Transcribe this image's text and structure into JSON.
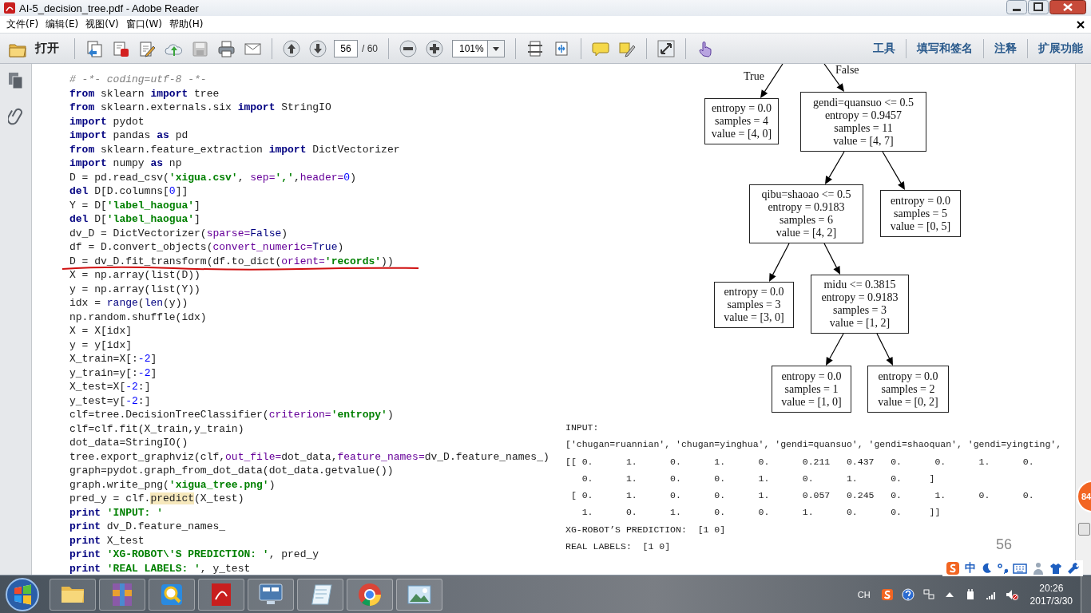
{
  "window": {
    "title": "AI-5_decision_tree.pdf - Adobe Reader"
  },
  "menu": [
    {
      "label": "文件(F)"
    },
    {
      "label": "编辑(E)"
    },
    {
      "label": "视图(V)"
    },
    {
      "label": "窗口(W)"
    },
    {
      "label": "帮助(H)"
    }
  ],
  "toolbar": {
    "open_label": "打开",
    "page_number": "56",
    "page_count": "/ 60",
    "zoom": "101%",
    "panels": [
      "工具",
      "填写和签名",
      "注释",
      "扩展功能"
    ]
  },
  "code": [
    {
      "underlined": false,
      "segments": [
        {
          "kind": "comment",
          "text": "# -*- coding=utf-8 -*-"
        }
      ]
    },
    {
      "underlined": false,
      "segments": [
        {
          "kind": "kw",
          "text": "from"
        },
        {
          "kind": "plain",
          "text": " sklearn "
        },
        {
          "kind": "kw",
          "text": "import"
        },
        {
          "kind": "plain",
          "text": " tree"
        }
      ]
    },
    {
      "underlined": false,
      "segments": [
        {
          "kind": "kw",
          "text": "from"
        },
        {
          "kind": "plain",
          "text": " sklearn.externals.six "
        },
        {
          "kind": "kw",
          "text": "import"
        },
        {
          "kind": "plain",
          "text": " StringIO"
        }
      ]
    },
    {
      "underlined": false,
      "segments": [
        {
          "kind": "kw",
          "text": "import"
        },
        {
          "kind": "plain",
          "text": " pydot"
        }
      ]
    },
    {
      "underlined": false,
      "segments": [
        {
          "kind": "kw",
          "text": "import"
        },
        {
          "kind": "plain",
          "text": " pandas "
        },
        {
          "kind": "kw",
          "text": "as"
        },
        {
          "kind": "plain",
          "text": " pd"
        }
      ]
    },
    {
      "underlined": false,
      "segments": [
        {
          "kind": "kw",
          "text": "from"
        },
        {
          "kind": "plain",
          "text": " sklearn.feature_extraction "
        },
        {
          "kind": "kw",
          "text": "import"
        },
        {
          "kind": "plain",
          "text": " DictVectorizer"
        }
      ]
    },
    {
      "underlined": false,
      "segments": [
        {
          "kind": "kw",
          "text": "import"
        },
        {
          "kind": "plain",
          "text": " numpy "
        },
        {
          "kind": "kw",
          "text": "as"
        },
        {
          "kind": "plain",
          "text": " np"
        }
      ]
    },
    {
      "underlined": false,
      "segments": [
        {
          "kind": "plain",
          "text": "D = pd.read_csv("
        },
        {
          "kind": "str",
          "text": "'xigua.csv'"
        },
        {
          "kind": "plain",
          "text": ", "
        },
        {
          "kind": "param",
          "text": "sep="
        },
        {
          "kind": "str",
          "text": "','"
        },
        {
          "kind": "plain",
          "text": ","
        },
        {
          "kind": "param",
          "text": "header="
        },
        {
          "kind": "num",
          "text": "0"
        },
        {
          "kind": "plain",
          "text": ")"
        }
      ]
    },
    {
      "underlined": false,
      "segments": [
        {
          "kind": "kw",
          "text": "del"
        },
        {
          "kind": "plain",
          "text": " D[D.columns["
        },
        {
          "kind": "num",
          "text": "0"
        },
        {
          "kind": "plain",
          "text": "]]"
        }
      ]
    },
    {
      "underlined": false,
      "segments": [
        {
          "kind": "plain",
          "text": "Y = D["
        },
        {
          "kind": "str",
          "text": "'label_haogua'"
        },
        {
          "kind": "plain",
          "text": "]"
        }
      ]
    },
    {
      "underlined": false,
      "segments": [
        {
          "kind": "kw",
          "text": "del"
        },
        {
          "kind": "plain",
          "text": " D["
        },
        {
          "kind": "str",
          "text": "'label_haogua'"
        },
        {
          "kind": "plain",
          "text": "]"
        }
      ]
    },
    {
      "underlined": false,
      "segments": [
        {
          "kind": "plain",
          "text": "dv_D = DictVectorizer("
        },
        {
          "kind": "param",
          "text": "sparse="
        },
        {
          "kind": "builtin",
          "text": "False"
        },
        {
          "kind": "plain",
          "text": ")"
        }
      ]
    },
    {
      "underlined": false,
      "segments": [
        {
          "kind": "plain",
          "text": "df = D.convert_objects("
        },
        {
          "kind": "param",
          "text": "convert_numeric="
        },
        {
          "kind": "builtin",
          "text": "True"
        },
        {
          "kind": "plain",
          "text": ")"
        }
      ]
    },
    {
      "underlined": true,
      "segments": [
        {
          "kind": "plain",
          "text": "D = dv_D.fit_transform(df.to_dict("
        },
        {
          "kind": "param",
          "text": "orient="
        },
        {
          "kind": "str",
          "text": "'records'"
        },
        {
          "kind": "plain",
          "text": "))"
        }
      ]
    },
    {
      "underlined": false,
      "segments": [
        {
          "kind": "plain",
          "text": "X = np.array(list(D))"
        }
      ]
    },
    {
      "underlined": false,
      "segments": [
        {
          "kind": "plain",
          "text": "y = np.array(list(Y))"
        }
      ]
    },
    {
      "underlined": false,
      "segments": [
        {
          "kind": "plain",
          "text": "idx = "
        },
        {
          "kind": "builtin",
          "text": "range"
        },
        {
          "kind": "plain",
          "text": "("
        },
        {
          "kind": "builtin",
          "text": "len"
        },
        {
          "kind": "plain",
          "text": "(y))"
        }
      ]
    },
    {
      "underlined": false,
      "segments": [
        {
          "kind": "plain",
          "text": "np.random.shuffle(idx)"
        }
      ]
    },
    {
      "underlined": false,
      "segments": [
        {
          "kind": "plain",
          "text": "X = X[idx]"
        }
      ]
    },
    {
      "underlined": false,
      "segments": [
        {
          "kind": "plain",
          "text": "y = y[idx]"
        }
      ]
    },
    {
      "underlined": false,
      "segments": [
        {
          "kind": "plain",
          "text": "X_train=X[:"
        },
        {
          "kind": "num",
          "text": "-2"
        },
        {
          "kind": "plain",
          "text": "]"
        }
      ]
    },
    {
      "underlined": false,
      "segments": [
        {
          "kind": "plain",
          "text": "y_train=y[:"
        },
        {
          "kind": "num",
          "text": "-2"
        },
        {
          "kind": "plain",
          "text": "]"
        }
      ]
    },
    {
      "underlined": false,
      "segments": [
        {
          "kind": "plain",
          "text": "X_test=X["
        },
        {
          "kind": "num",
          "text": "-2"
        },
        {
          "kind": "plain",
          "text": ":]"
        }
      ]
    },
    {
      "underlined": false,
      "segments": [
        {
          "kind": "plain",
          "text": "y_test=y["
        },
        {
          "kind": "num",
          "text": "-2"
        },
        {
          "kind": "plain",
          "text": ":]"
        }
      ]
    },
    {
      "underlined": false,
      "segments": [
        {
          "kind": "plain",
          "text": "clf=tree.DecisionTreeClassifier("
        },
        {
          "kind": "param",
          "text": "criterion="
        },
        {
          "kind": "str",
          "text": "'entropy'"
        },
        {
          "kind": "plain",
          "text": ")"
        }
      ]
    },
    {
      "underlined": false,
      "segments": [
        {
          "kind": "plain",
          "text": "clf=clf.fit(X_train,y_train)"
        }
      ]
    },
    {
      "underlined": false,
      "segments": [
        {
          "kind": "plain",
          "text": "dot_data=StringIO()"
        }
      ]
    },
    {
      "underlined": false,
      "segments": [
        {
          "kind": "plain",
          "text": "tree.export_graphviz(clf,"
        },
        {
          "kind": "param",
          "text": "out_file="
        },
        {
          "kind": "plain",
          "text": "dot_data,"
        },
        {
          "kind": "param",
          "text": "feature_names="
        },
        {
          "kind": "plain",
          "text": "dv_D.feature_names_)"
        }
      ]
    },
    {
      "underlined": false,
      "segments": [
        {
          "kind": "plain",
          "text": "graph=pydot.graph_from_dot_data(dot_data.getvalue())"
        }
      ]
    },
    {
      "underlined": false,
      "segments": [
        {
          "kind": "plain",
          "text": "graph.write_png("
        },
        {
          "kind": "str",
          "text": "'xigua_tree.png'"
        },
        {
          "kind": "plain",
          "text": ")"
        }
      ]
    },
    {
      "underlined": false,
      "segments": [
        {
          "kind": "plain",
          "text": "pred_y = clf."
        },
        {
          "kind": "highlight",
          "text": "predict"
        },
        {
          "kind": "plain",
          "text": "(X_test)"
        }
      ]
    },
    {
      "underlined": false,
      "segments": [
        {
          "kind": "kw",
          "text": "print "
        },
        {
          "kind": "str",
          "text": "'INPUT: '"
        }
      ]
    },
    {
      "underlined": false,
      "segments": [
        {
          "kind": "kw",
          "text": "print"
        },
        {
          "kind": "plain",
          "text": " dv_D.feature_names_"
        }
      ]
    },
    {
      "underlined": false,
      "segments": [
        {
          "kind": "kw",
          "text": "print"
        },
        {
          "kind": "plain",
          "text": " X_test"
        }
      ]
    },
    {
      "underlined": false,
      "segments": [
        {
          "kind": "kw",
          "text": "print "
        },
        {
          "kind": "str",
          "text": "'XG-ROBOT\\'S PREDICTION: '"
        },
        {
          "kind": "plain",
          "text": ", pred_y"
        }
      ]
    },
    {
      "underlined": false,
      "segments": [
        {
          "kind": "kw",
          "text": "print "
        },
        {
          "kind": "str",
          "text": "'REAL LABELS: '"
        },
        {
          "kind": "plain",
          "text": ", y_test"
        }
      ]
    }
  ],
  "tree": {
    "children": [
      {
        "edge_label": "True",
        "lines": [
          "entropy = 0.0",
          "samples = 4",
          "value = [4, 0]"
        ]
      },
      {
        "edge_label": "False",
        "lines": [
          "gendi=quansuo <= 0.5",
          "entropy = 0.9457",
          "samples = 11",
          "value = [4, 7]"
        ],
        "children": [
          {
            "lines": [
              "qibu=shaoao <= 0.5",
              "entropy = 0.9183",
              "samples = 6",
              "value = [4, 2]"
            ],
            "children": [
              {
                "lines": [
                  "entropy = 0.0",
                  "samples = 3",
                  "value = [3, 0]"
                ]
              },
              {
                "lines": [
                  "midu <= 0.3815",
                  "entropy = 0.9183",
                  "samples = 3",
                  "value = [1, 2]"
                ],
                "children": [
                  {
                    "lines": [
                      "entropy = 0.0",
                      "samples = 1",
                      "value = [1, 0]"
                    ]
                  },
                  {
                    "lines": [
                      "entropy = 0.0",
                      "samples = 2",
                      "value = [0, 2]"
                    ]
                  }
                ]
              }
            ]
          },
          {
            "lines": [
              "entropy = 0.0",
              "samples = 5",
              "value = [0, 5]"
            ]
          }
        ]
      }
    ]
  },
  "output": [
    "INPUT:",
    "['chugan=ruannian', 'chugan=yinghua', 'gendi=quansuo', 'gendi=shaoquan', 'gendi=yingting',",
    "[[ 0.      1.      0.      1.      0.      0.211   0.437   0.      0.      1.      0.",
    "   0.      1.      0.      0.      1.      0.      1.      0.     ]",
    " [ 0.      1.      0.      0.      1.      0.057   0.245   0.      1.      0.      0.",
    "   1.      0.      1.      0.      0.      1.      0.      0.     ]]",
    "XG-ROBOT’S PREDICTION:  [1 0]",
    "REAL LABELS:  [1 0]"
  ],
  "page_label": "56",
  "floating_badge": "84",
  "ime_bar": {
    "mode": "中"
  },
  "taskbar": {
    "apps": [
      {
        "kind": "folder"
      },
      {
        "kind": "archive"
      },
      {
        "kind": "search"
      },
      {
        "kind": "pdf"
      },
      {
        "kind": "monitor"
      },
      {
        "kind": "notepad"
      },
      {
        "kind": "browser"
      },
      {
        "kind": "photo"
      }
    ],
    "language": "CH",
    "time": "20:26",
    "date": "2017/3/30"
  }
}
